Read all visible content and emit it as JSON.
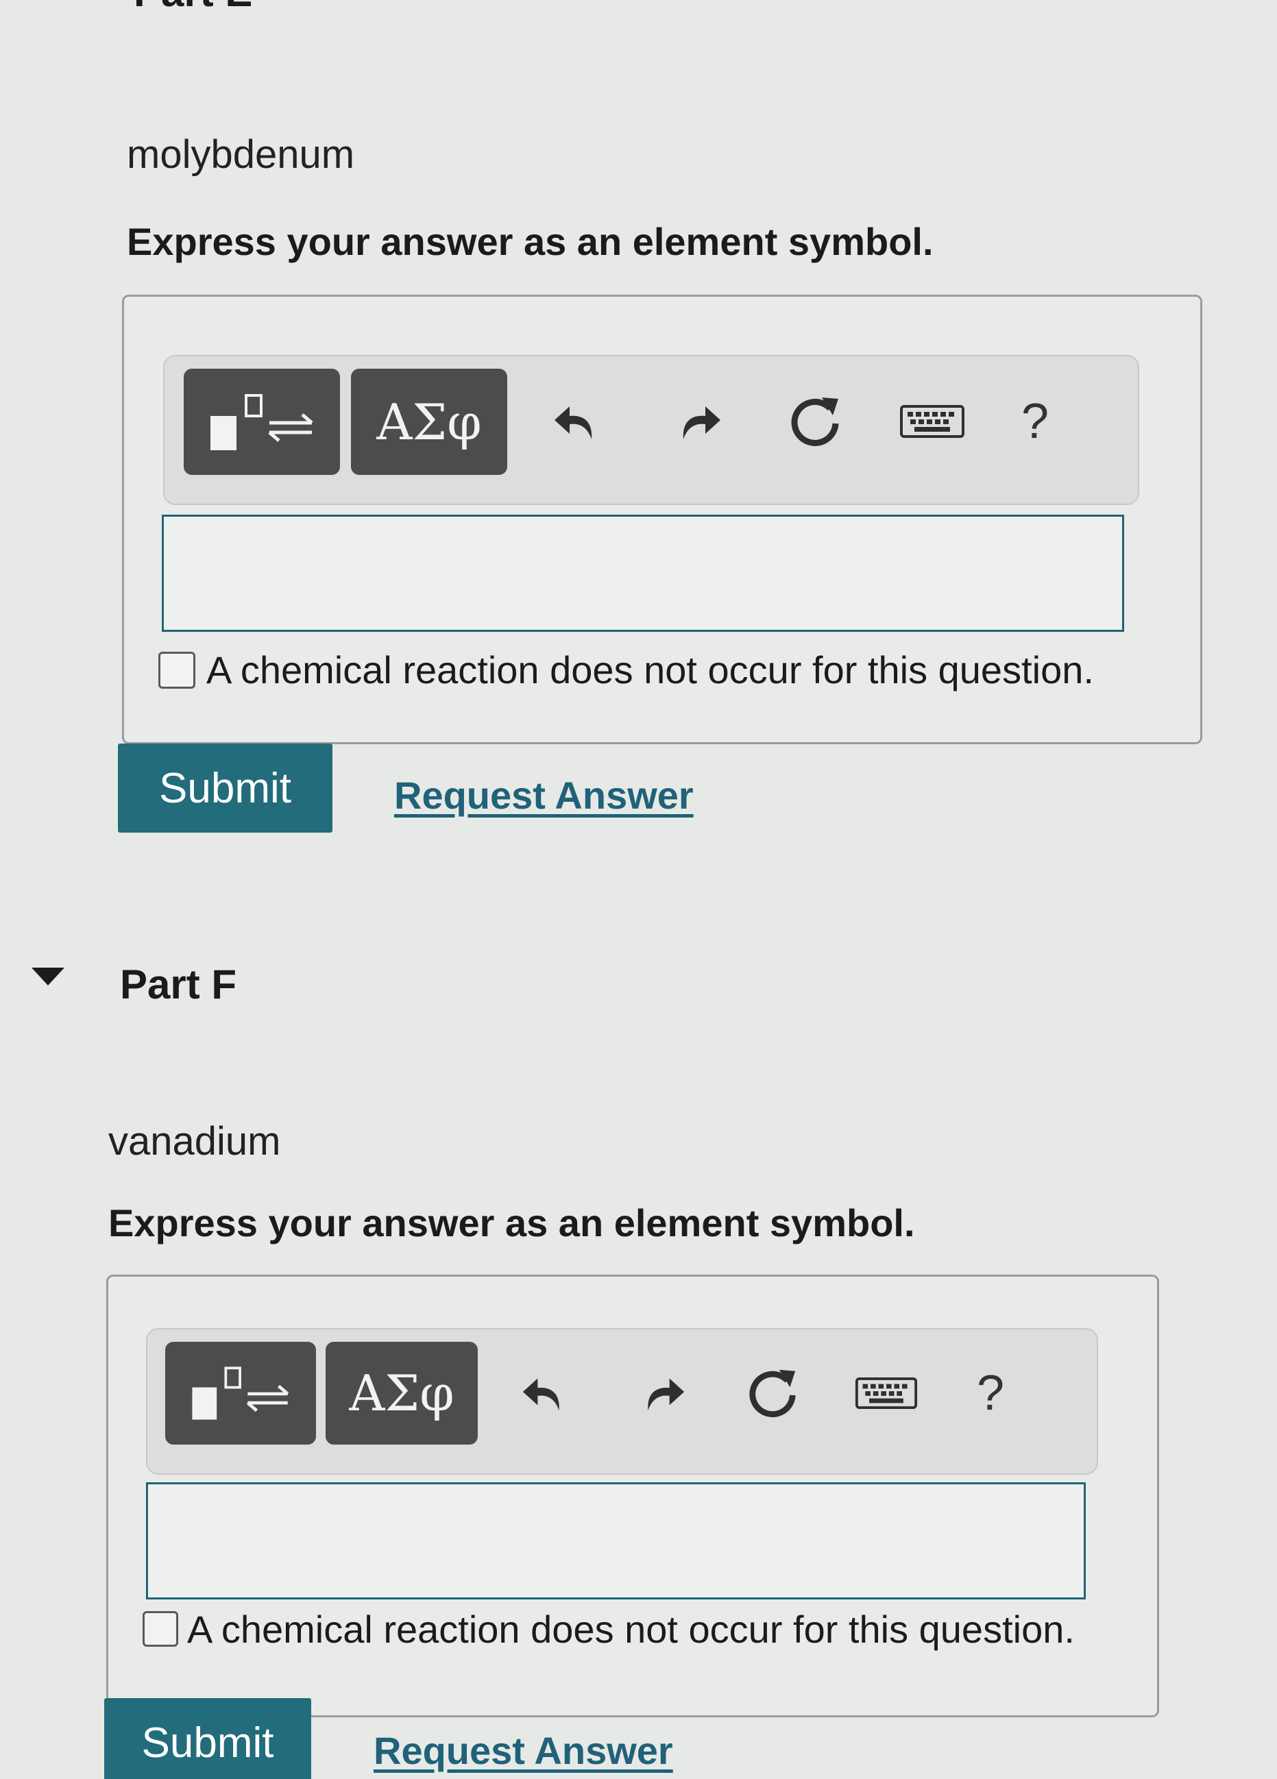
{
  "partE": {
    "heading_fragment": "Part E",
    "element": "molybdenum",
    "instruction": "Express your answer as an element symbol.",
    "toolbar": {
      "template_icon": "template-reaction-icon",
      "greek_label": "ΑΣφ",
      "undo_icon": "undo-icon",
      "redo_icon": "redo-icon",
      "reset_icon": "reset-icon",
      "keyboard_icon": "keyboard-icon",
      "help_label": "?"
    },
    "answer_value": "",
    "no_reaction_label": "A chemical reaction does not occur for this question.",
    "submit_label": "Submit",
    "request_label": "Request Answer"
  },
  "partF": {
    "title": "Part F",
    "element": "vanadium",
    "instruction": "Express your answer as an element symbol.",
    "toolbar": {
      "template_icon": "template-reaction-icon",
      "greek_label": "ΑΣφ",
      "undo_icon": "undo-icon",
      "redo_icon": "redo-icon",
      "reset_icon": "reset-icon",
      "keyboard_icon": "keyboard-icon",
      "help_label": "?"
    },
    "answer_value": "",
    "no_reaction_label": "A chemical reaction does not occur for this question.",
    "submit_label": "Submit",
    "request_label": "Request Answer"
  },
  "colors": {
    "accent": "#226c7b",
    "link": "#1f6279",
    "tool_button": "#4b4c4c"
  }
}
